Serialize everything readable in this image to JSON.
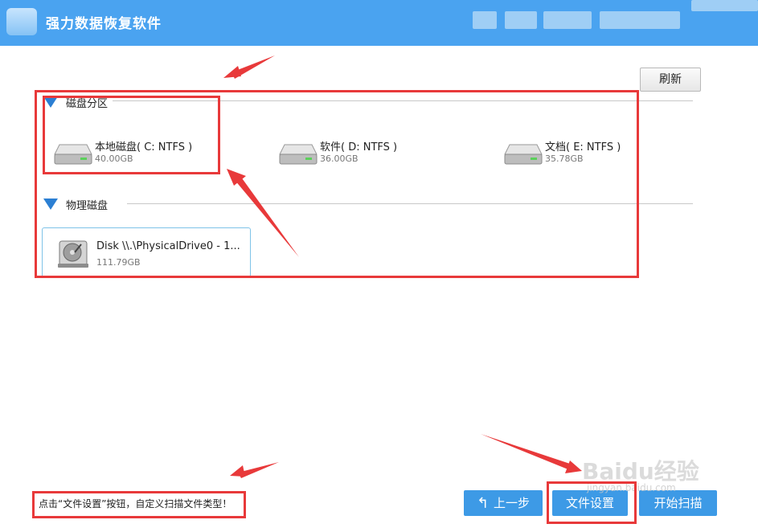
{
  "window": {
    "title": "强力数据恢复软件"
  },
  "toolbar": {
    "refresh_label": "刷新"
  },
  "partitions": {
    "label": "磁盘分区",
    "items": [
      {
        "name": "本地磁盘( C: NTFS )",
        "size": "40.00GB"
      },
      {
        "name": "软件( D: NTFS )",
        "size": "36.00GB"
      },
      {
        "name": "文档( E: NTFS )",
        "size": "35.78GB"
      }
    ]
  },
  "physical": {
    "label": "物理磁盘",
    "items": [
      {
        "name": "Disk \\\\.\\PhysicalDrive0 - 1...",
        "size": "111.79GB"
      }
    ]
  },
  "footer": {
    "hint": "点击“文件设置”按钮，自定义扫描文件类型！",
    "back_label": "上一步",
    "file_settings_label": "文件设置",
    "start_scan_label": "开始扫描"
  },
  "watermark": {
    "brand": "Baidu经验",
    "url": "jingyan.baidu.com"
  },
  "colors": {
    "titlebar": "#4aa3f0",
    "accent": "#3d9ae6",
    "annotation": "#e8393a"
  }
}
